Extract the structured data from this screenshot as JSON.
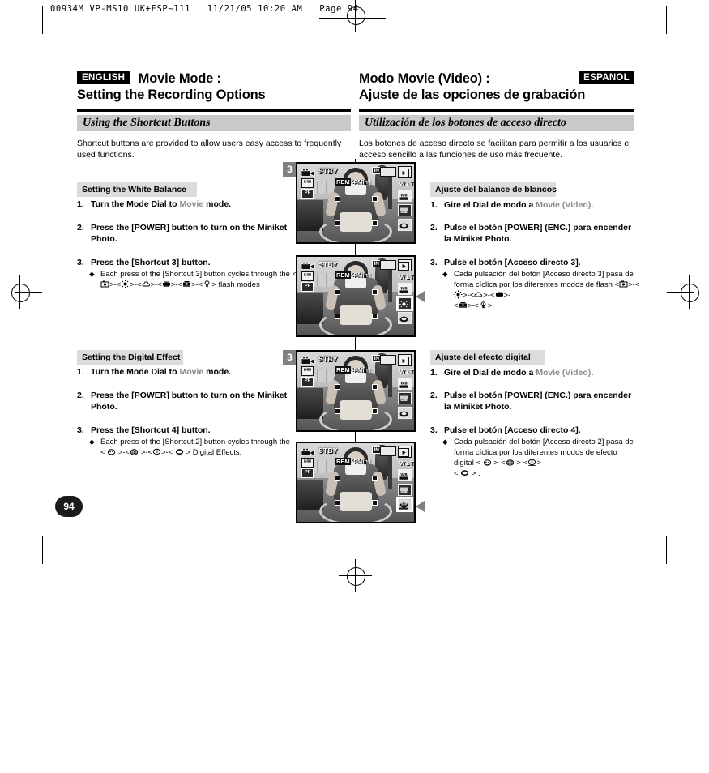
{
  "slug": {
    "text": "00934M VP-MS10 UK+ESP~111   11/21/05 10:20 AM   Page 94"
  },
  "english": {
    "lang_tag": "ENGLISH",
    "title_line1": "Movie Mode :",
    "title_line2": "Setting the Recording Options",
    "band": "Using the Shortcut Buttons",
    "intro": "Shortcut buttons are provided to allow users easy access to frequently used functions.",
    "sections": [
      {
        "subhead": "Setting the White Balance",
        "steps": [
          {
            "num": "1.",
            "pre": "Turn the Mode Dial to ",
            "grey": "Movie",
            "post": " mode."
          },
          {
            "num": "2.",
            "pre": "Press the [POWER] button to turn on the Miniket Photo.",
            "grey": "",
            "post": ""
          },
          {
            "num": "3.",
            "pre": "Press the [Shortcut 3] button.",
            "grey": "",
            "post": ""
          }
        ],
        "bullet_pre": "Each press of the [Shortcut 3] button cycles through the ",
        "bullet_icons": [
          "wb-auto-icon",
          "wb-daylight-icon",
          "wb-cloudy-icon",
          "wb-fluorescent-icon",
          "wb-fluorescent-h-icon",
          "wb-tungsten-icon"
        ],
        "bullet_post": " flash modes"
      },
      {
        "subhead": "Setting the Digital Effect",
        "steps": [
          {
            "num": "1.",
            "pre": "Turn the Mode Dial to ",
            "grey": "Movie",
            "post": " mode."
          },
          {
            "num": "2.",
            "pre": "Press the [POWER] button to turn on the Miniket Photo.",
            "grey": "",
            "post": ""
          },
          {
            "num": "3.",
            "pre": "Press the [Shortcut 4] button.",
            "grey": "",
            "post": ""
          }
        ],
        "bullet_pre": "Each press of the [Shortcut 2] button cycles through the ",
        "bullet_icons": [
          "effect-art-icon",
          "effect-mosaic-icon",
          "effect-sepia-icon",
          "effect-negative-icon"
        ],
        "bullet_post": " Digital Effects."
      }
    ]
  },
  "spanish": {
    "lang_tag": "ESPANOL",
    "title_line1": "Modo Movie (Video) :",
    "title_line2": "Ajuste de las opciones de grabación",
    "band": "Utilización de los botones de acceso directo",
    "intro": "Los botones de acceso directo se facilitan para permitir a los usuarios el acceso sencillo a las funciones de uso más frecuente.",
    "sections": [
      {
        "subhead": "Ajuste del balance de blancos",
        "steps": [
          {
            "num": "1.",
            "pre": "Gire el Dial de modo a ",
            "grey": "Movie (Video)",
            "post": "."
          },
          {
            "num": "2.",
            "pre": "Pulse el botón [POWER] (ENC.) para encender la Miniket Photo.",
            "grey": "",
            "post": ""
          },
          {
            "num": "3.",
            "pre": "Pulse el botón [Acceso directo 3].",
            "grey": "",
            "post": ""
          }
        ],
        "bullet_pre": "Cada pulsación del botón [Acceso directo 3] pasa de forma cíclica por los diferentes modos de flash ",
        "bullet_icons": [
          "wb-auto-icon",
          "wb-daylight-icon",
          "wb-cloudy-icon",
          "wb-fluorescent-icon",
          "wb-fluorescent-h-icon",
          "wb-tungsten-icon"
        ],
        "bullet_post": "."
      },
      {
        "subhead": "Ajuste del efecto digital",
        "steps": [
          {
            "num": "1.",
            "pre": "Gire el Dial de modo a ",
            "grey": "Movie (Video)",
            "post": "."
          },
          {
            "num": "2.",
            "pre": "Pulse el botón [POWER] (ENC.) para encender la Miniket Photo.",
            "grey": "",
            "post": ""
          },
          {
            "num": "3.",
            "pre": "Pulse el botón [Acceso directo 4].",
            "grey": "",
            "post": ""
          }
        ],
        "bullet_pre": "Cada pulsación del botón [Acceso directo 2] pasa de forma cíclica por los diferentes modos de efecto digital ",
        "bullet_icons": [
          "effect-art-icon",
          "effect-mosaic-icon",
          "effect-sepia-icon",
          "effect-negative-icon"
        ],
        "bullet_post": " ."
      }
    ]
  },
  "screens": [
    {
      "callout": "3",
      "status": "STBY",
      "in_tag": "IN",
      "remaining": "REM 4 Min",
      "left_chips": [
        "640",
        "PF"
      ],
      "highlight": null
    },
    {
      "callout": "",
      "status": "STBY",
      "in_tag": "IN",
      "remaining": "REM 4 Min",
      "left_chips": [
        "640",
        "PF"
      ],
      "highlight": "wb-daylight"
    },
    {
      "callout": "3",
      "status": "STBY",
      "in_tag": "IN",
      "remaining": "REM 4 Min",
      "left_chips": [
        "640",
        "PF"
      ],
      "highlight": null
    },
    {
      "callout": "",
      "status": "STBY",
      "in_tag": "IN",
      "remaining": "REM 4 Min",
      "left_chips": [
        "640",
        "PF"
      ],
      "highlight": "effect-sepia"
    }
  ],
  "page_number": "94",
  "colors": {
    "band_grey": "#c9c9c9",
    "subhead_grey": "#dcdcdc",
    "grey_text": "#8c8c8c",
    "callout_grey": "#808080",
    "black": "#000000"
  }
}
